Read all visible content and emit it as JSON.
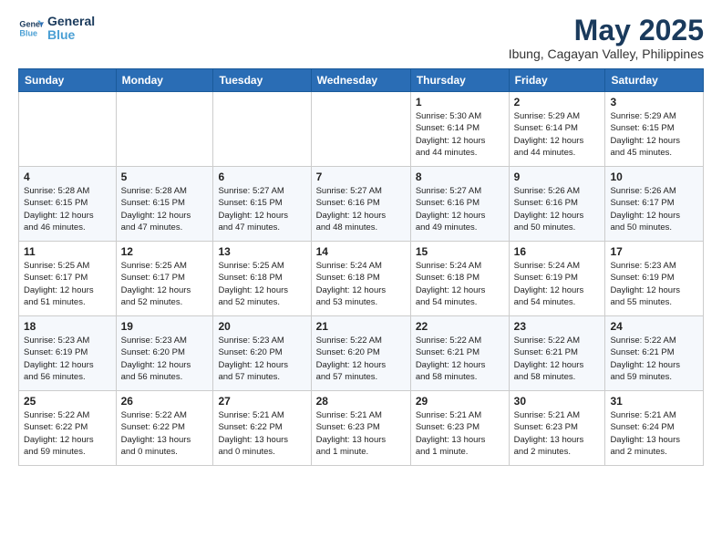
{
  "logo": {
    "line1": "General",
    "line2": "Blue"
  },
  "title": "May 2025",
  "location": "Ibung, Cagayan Valley, Philippines",
  "days_of_week": [
    "Sunday",
    "Monday",
    "Tuesday",
    "Wednesday",
    "Thursday",
    "Friday",
    "Saturday"
  ],
  "weeks": [
    [
      {
        "day": "",
        "info": ""
      },
      {
        "day": "",
        "info": ""
      },
      {
        "day": "",
        "info": ""
      },
      {
        "day": "",
        "info": ""
      },
      {
        "day": "1",
        "info": "Sunrise: 5:30 AM\nSunset: 6:14 PM\nDaylight: 12 hours\nand 44 minutes."
      },
      {
        "day": "2",
        "info": "Sunrise: 5:29 AM\nSunset: 6:14 PM\nDaylight: 12 hours\nand 44 minutes."
      },
      {
        "day": "3",
        "info": "Sunrise: 5:29 AM\nSunset: 6:15 PM\nDaylight: 12 hours\nand 45 minutes."
      }
    ],
    [
      {
        "day": "4",
        "info": "Sunrise: 5:28 AM\nSunset: 6:15 PM\nDaylight: 12 hours\nand 46 minutes."
      },
      {
        "day": "5",
        "info": "Sunrise: 5:28 AM\nSunset: 6:15 PM\nDaylight: 12 hours\nand 47 minutes."
      },
      {
        "day": "6",
        "info": "Sunrise: 5:27 AM\nSunset: 6:15 PM\nDaylight: 12 hours\nand 47 minutes."
      },
      {
        "day": "7",
        "info": "Sunrise: 5:27 AM\nSunset: 6:16 PM\nDaylight: 12 hours\nand 48 minutes."
      },
      {
        "day": "8",
        "info": "Sunrise: 5:27 AM\nSunset: 6:16 PM\nDaylight: 12 hours\nand 49 minutes."
      },
      {
        "day": "9",
        "info": "Sunrise: 5:26 AM\nSunset: 6:16 PM\nDaylight: 12 hours\nand 50 minutes."
      },
      {
        "day": "10",
        "info": "Sunrise: 5:26 AM\nSunset: 6:17 PM\nDaylight: 12 hours\nand 50 minutes."
      }
    ],
    [
      {
        "day": "11",
        "info": "Sunrise: 5:25 AM\nSunset: 6:17 PM\nDaylight: 12 hours\nand 51 minutes."
      },
      {
        "day": "12",
        "info": "Sunrise: 5:25 AM\nSunset: 6:17 PM\nDaylight: 12 hours\nand 52 minutes."
      },
      {
        "day": "13",
        "info": "Sunrise: 5:25 AM\nSunset: 6:18 PM\nDaylight: 12 hours\nand 52 minutes."
      },
      {
        "day": "14",
        "info": "Sunrise: 5:24 AM\nSunset: 6:18 PM\nDaylight: 12 hours\nand 53 minutes."
      },
      {
        "day": "15",
        "info": "Sunrise: 5:24 AM\nSunset: 6:18 PM\nDaylight: 12 hours\nand 54 minutes."
      },
      {
        "day": "16",
        "info": "Sunrise: 5:24 AM\nSunset: 6:19 PM\nDaylight: 12 hours\nand 54 minutes."
      },
      {
        "day": "17",
        "info": "Sunrise: 5:23 AM\nSunset: 6:19 PM\nDaylight: 12 hours\nand 55 minutes."
      }
    ],
    [
      {
        "day": "18",
        "info": "Sunrise: 5:23 AM\nSunset: 6:19 PM\nDaylight: 12 hours\nand 56 minutes."
      },
      {
        "day": "19",
        "info": "Sunrise: 5:23 AM\nSunset: 6:20 PM\nDaylight: 12 hours\nand 56 minutes."
      },
      {
        "day": "20",
        "info": "Sunrise: 5:23 AM\nSunset: 6:20 PM\nDaylight: 12 hours\nand 57 minutes."
      },
      {
        "day": "21",
        "info": "Sunrise: 5:22 AM\nSunset: 6:20 PM\nDaylight: 12 hours\nand 57 minutes."
      },
      {
        "day": "22",
        "info": "Sunrise: 5:22 AM\nSunset: 6:21 PM\nDaylight: 12 hours\nand 58 minutes."
      },
      {
        "day": "23",
        "info": "Sunrise: 5:22 AM\nSunset: 6:21 PM\nDaylight: 12 hours\nand 58 minutes."
      },
      {
        "day": "24",
        "info": "Sunrise: 5:22 AM\nSunset: 6:21 PM\nDaylight: 12 hours\nand 59 minutes."
      }
    ],
    [
      {
        "day": "25",
        "info": "Sunrise: 5:22 AM\nSunset: 6:22 PM\nDaylight: 12 hours\nand 59 minutes."
      },
      {
        "day": "26",
        "info": "Sunrise: 5:22 AM\nSunset: 6:22 PM\nDaylight: 13 hours\nand 0 minutes."
      },
      {
        "day": "27",
        "info": "Sunrise: 5:21 AM\nSunset: 6:22 PM\nDaylight: 13 hours\nand 0 minutes."
      },
      {
        "day": "28",
        "info": "Sunrise: 5:21 AM\nSunset: 6:23 PM\nDaylight: 13 hours\nand 1 minute."
      },
      {
        "day": "29",
        "info": "Sunrise: 5:21 AM\nSunset: 6:23 PM\nDaylight: 13 hours\nand 1 minute."
      },
      {
        "day": "30",
        "info": "Sunrise: 5:21 AM\nSunset: 6:23 PM\nDaylight: 13 hours\nand 2 minutes."
      },
      {
        "day": "31",
        "info": "Sunrise: 5:21 AM\nSunset: 6:24 PM\nDaylight: 13 hours\nand 2 minutes."
      }
    ]
  ]
}
